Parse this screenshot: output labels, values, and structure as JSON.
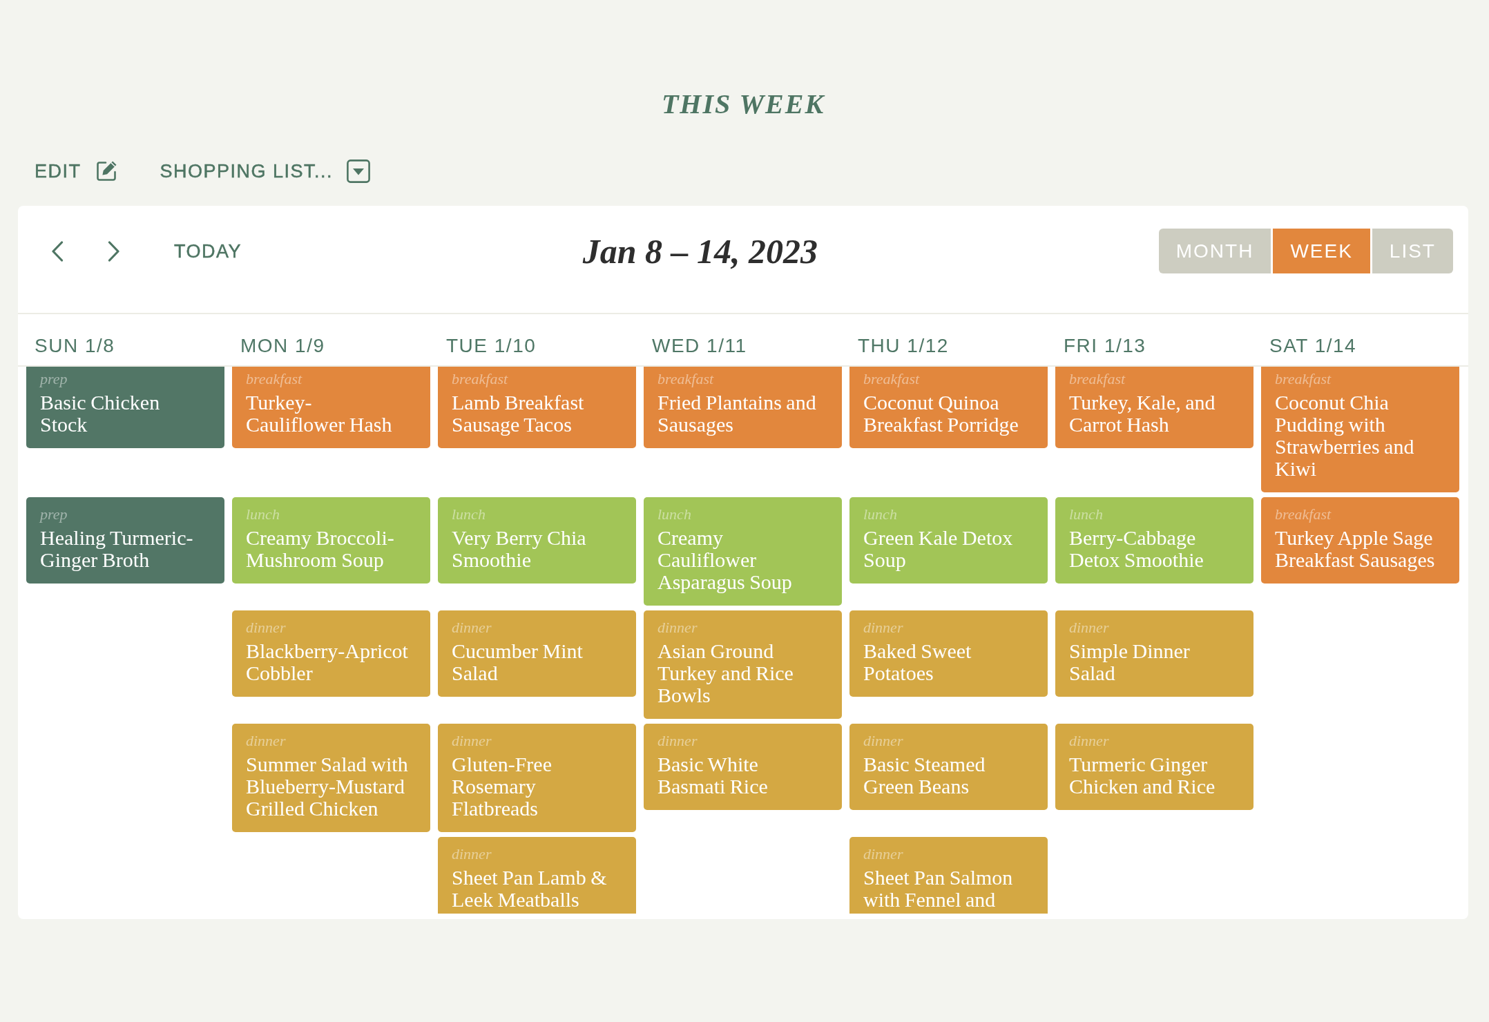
{
  "page_title": "THIS WEEK",
  "toolbar": [
    {
      "label": "EDIT",
      "kind": "edit"
    },
    {
      "label": "SHOPPING LIST...",
      "kind": "dropdown"
    }
  ],
  "calendar": {
    "today_label": "TODAY",
    "range_title": "Jan 8 – 14, 2023",
    "views": [
      {
        "label": "MONTH",
        "selected": false
      },
      {
        "label": "WEEK",
        "selected": true
      },
      {
        "label": "LIST",
        "selected": false
      }
    ],
    "days": [
      {
        "header": "SUN 1/8",
        "events": [
          {
            "meal": "prep",
            "title": "Basic Chicken Stock",
            "color": "#527666"
          },
          {
            "meal": "prep",
            "title": "Healing Turmeric-Ginger Broth",
            "color": "#527666"
          }
        ]
      },
      {
        "header": "MON 1/9",
        "events": [
          {
            "meal": "breakfast",
            "title": "Turkey-Cauliflower Hash",
            "color": "#e2873d"
          },
          {
            "meal": "lunch",
            "title": "Creamy Broccoli-Mushroom Soup",
            "color": "#a2c557"
          },
          {
            "meal": "dinner",
            "title": "Blackberry-Apricot Cobbler",
            "color": "#d4a843"
          },
          {
            "meal": "dinner",
            "title": "Summer Salad with Blueberry-Mustard Grilled Chicken",
            "color": "#d4a843"
          }
        ]
      },
      {
        "header": "TUE 1/10",
        "events": [
          {
            "meal": "breakfast",
            "title": "Lamb Breakfast Sausage Tacos",
            "color": "#e2873d"
          },
          {
            "meal": "lunch",
            "title": "Very Berry Chia Smoothie",
            "color": "#a2c557"
          },
          {
            "meal": "dinner",
            "title": "Cucumber Mint Salad",
            "color": "#d4a843"
          },
          {
            "meal": "dinner",
            "title": "Gluten-Free Rosemary Flatbreads",
            "color": "#d4a843"
          },
          {
            "meal": "dinner",
            "title": "Sheet Pan Lamb & Leek Meatballs",
            "color": "#d4a843"
          }
        ]
      },
      {
        "header": "WED 1/11",
        "events": [
          {
            "meal": "breakfast",
            "title": "Fried Plantains and Sausages",
            "color": "#e2873d"
          },
          {
            "meal": "lunch",
            "title": "Creamy Cauliflower Asparagus Soup",
            "color": "#a2c557"
          },
          {
            "meal": "dinner",
            "title": "Asian Ground Turkey and Rice Bowls",
            "color": "#d4a843"
          },
          {
            "meal": "dinner",
            "title": "Basic White Basmati Rice",
            "color": "#d4a843"
          }
        ]
      },
      {
        "header": "THU 1/12",
        "events": [
          {
            "meal": "breakfast",
            "title": "Coconut Quinoa Breakfast Porridge",
            "color": "#e2873d"
          },
          {
            "meal": "lunch",
            "title": "Green Kale Detox Soup",
            "color": "#a2c557"
          },
          {
            "meal": "dinner",
            "title": "Baked Sweet Potatoes",
            "color": "#d4a843"
          },
          {
            "meal": "dinner",
            "title": "Basic Steamed Green Beans",
            "color": "#d4a843"
          },
          {
            "meal": "dinner",
            "title": "Sheet Pan Salmon with Fennel and",
            "color": "#d4a843"
          }
        ]
      },
      {
        "header": "FRI 1/13",
        "events": [
          {
            "meal": "breakfast",
            "title": "Turkey, Kale, and Carrot Hash",
            "color": "#e2873d"
          },
          {
            "meal": "lunch",
            "title": "Berry-Cabbage Detox Smoothie",
            "color": "#a2c557"
          },
          {
            "meal": "dinner",
            "title": "Simple Dinner Salad",
            "color": "#d4a843"
          },
          {
            "meal": "dinner",
            "title": "Turmeric Ginger Chicken and Rice",
            "color": "#d4a843"
          }
        ]
      },
      {
        "header": "SAT 1/14",
        "events": [
          {
            "meal": "breakfast",
            "title": "Coconut Chia Pudding with Strawberries and Kiwi",
            "color": "#e2873d"
          },
          {
            "meal": "breakfast",
            "title": "Turkey Apple Sage Breakfast Sausages",
            "color": "#e2873d"
          }
        ]
      }
    ]
  }
}
